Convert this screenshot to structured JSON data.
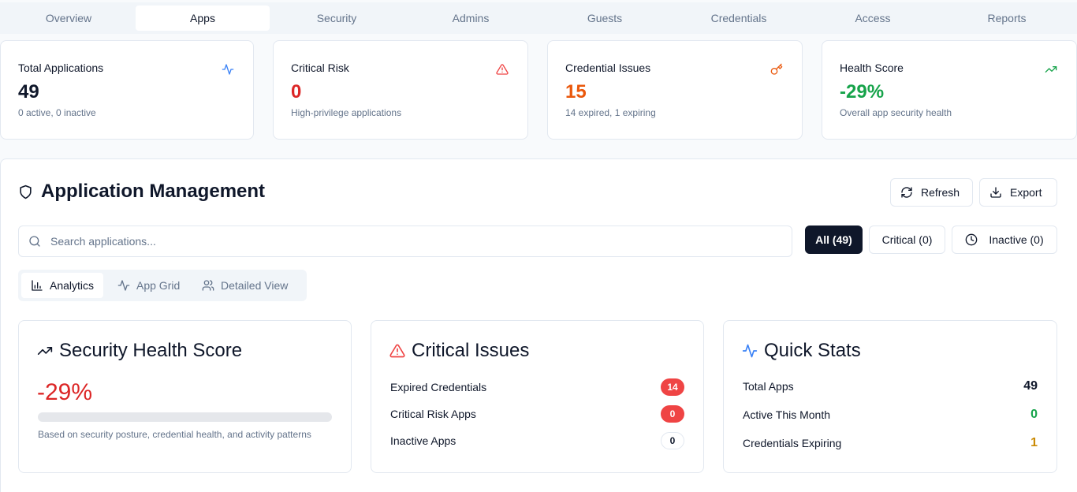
{
  "tabs": [
    "Overview",
    "Apps",
    "Security",
    "Admins",
    "Guests",
    "Credentials",
    "Access",
    "Reports"
  ],
  "active_tab": "Apps",
  "stats": [
    {
      "label": "Total Applications",
      "value": "49",
      "sub": "0 active, 0 inactive",
      "icon": "activity-icon",
      "color": "#0f172a"
    },
    {
      "label": "Critical Risk",
      "value": "0",
      "sub": "High-privilege applications",
      "icon": "alert-triangle-icon",
      "color": "#dc2626"
    },
    {
      "label": "Credential Issues",
      "value": "15",
      "sub": "14 expired, 1 expiring",
      "icon": "key-icon",
      "color": "#ea580c"
    },
    {
      "label": "Health Score",
      "value": "-29%",
      "sub": "Overall app security health",
      "icon": "trending-up-icon",
      "color": "#16a34a"
    }
  ],
  "management": {
    "title": "Application Management",
    "refresh_label": "Refresh",
    "export_label": "Export",
    "search_placeholder": "Search applications...",
    "filters": [
      "All (49)",
      "Critical (0)",
      "Inactive (0)"
    ],
    "view_tabs": [
      "Analytics",
      "App Grid",
      "Detailed View"
    ]
  },
  "health": {
    "title": "Security Health Score",
    "score": "-29%",
    "progress_percent": 0,
    "note": "Based on security posture, credential health, and activity patterns"
  },
  "critical": {
    "title": "Critical Issues",
    "rows": [
      {
        "label": "Expired Credentials",
        "count": "14"
      },
      {
        "label": "Critical Risk Apps",
        "count": "0"
      },
      {
        "label": "Inactive Apps",
        "count": "0"
      }
    ]
  },
  "quick": {
    "title": "Quick Stats",
    "rows": [
      {
        "label": "Total Apps",
        "value": "49",
        "color": "#0f172a"
      },
      {
        "label": "Active This Month",
        "value": "0",
        "color": "#16a34a"
      },
      {
        "label": "Credentials Expiring",
        "value": "1",
        "color": "#ca8a04"
      }
    ]
  },
  "colors": {
    "accent": "#3b82f6",
    "danger": "#ef4444",
    "success": "#16a34a",
    "warning": "#ea580c"
  }
}
